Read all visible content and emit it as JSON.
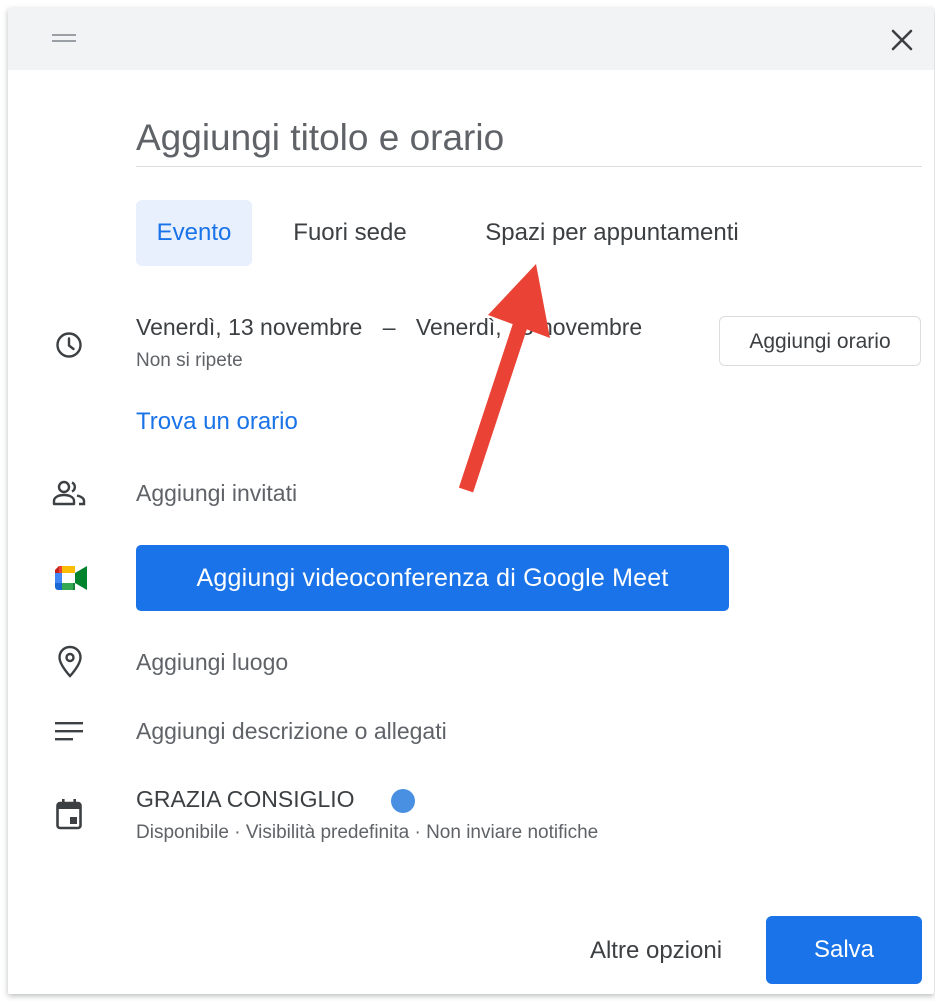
{
  "title_field": {
    "placeholder": "Aggiungi titolo e orario"
  },
  "tabs": [
    {
      "label": "Evento",
      "active": true
    },
    {
      "label": "Fuori sede",
      "active": false
    },
    {
      "label": "Spazi per appuntamenti",
      "active": false
    }
  ],
  "date": {
    "start": "Venerdì, 13 novembre",
    "separator": "–",
    "end": "Venerdì, 13 novembre",
    "recurrence": "Non si ripete",
    "add_time_label": "Aggiungi orario"
  },
  "find_time_label": "Trova un orario",
  "guests_label": "Aggiungi invitati",
  "meet_button_label": "Aggiungi videoconferenza di Google Meet",
  "location_label": "Aggiungi luogo",
  "description_label": "Aggiungi descrizione o allegati",
  "calendar": {
    "name": "GRAZIA CONSIGLIO",
    "details": "Disponibile · Visibilità predefinita · Non inviare notifiche",
    "dot_color": "#4a90e2"
  },
  "footer": {
    "more_options_label": "Altre opzioni",
    "save_label": "Salva"
  },
  "colors": {
    "accent": "#1a73e8",
    "annotation_arrow": "#ea4335"
  },
  "icons": [
    "drag-handle-icon",
    "close-icon",
    "clock-icon",
    "people-icon",
    "google-meet-icon",
    "location-pin-icon",
    "description-lines-icon",
    "calendar-icon"
  ]
}
